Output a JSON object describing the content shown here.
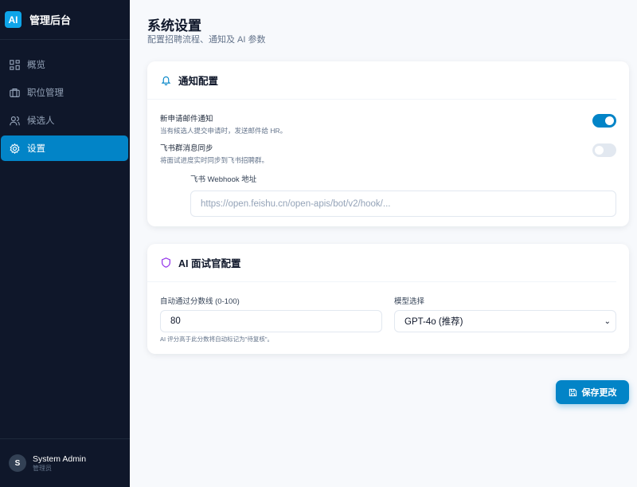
{
  "brand": {
    "logo": "AI",
    "name": "管理后台"
  },
  "nav": [
    {
      "label": "概览",
      "icon": "dashboard-icon"
    },
    {
      "label": "职位管理",
      "icon": "briefcase-icon"
    },
    {
      "label": "候选人",
      "icon": "users-icon"
    },
    {
      "label": "设置",
      "icon": "gear-icon",
      "active": true
    }
  ],
  "user": {
    "initial": "S",
    "name": "System Admin",
    "role": "管理员"
  },
  "page": {
    "title": "系统设置",
    "subtitle": "配置招聘流程、通知及 AI 参数"
  },
  "notify": {
    "title": "通知配置",
    "email": {
      "title": "新申请邮件通知",
      "desc": "当有候选人提交申请时，发送邮件给 HR。",
      "on": true
    },
    "feishu": {
      "title": "飞书群消息同步",
      "desc": "将面试进度实时同步到飞书招聘群。",
      "on": false
    },
    "webhook_label": "飞书 Webhook 地址",
    "webhook_placeholder": "https://open.feishu.cn/open-apis/bot/v2/hook/..."
  },
  "ai": {
    "title": "AI 面试官配置",
    "threshold_label": "自动通过分数线 (0-100)",
    "threshold_value": "80",
    "threshold_hint": "AI 评分高于此分数将自动标记为\"待复核\"。",
    "model_label": "模型选择",
    "model_value": "GPT-4o (推荐)"
  },
  "save_label": "保存更改",
  "colors": {
    "accent": "#0284c7",
    "sidebar": "#0f172a"
  }
}
